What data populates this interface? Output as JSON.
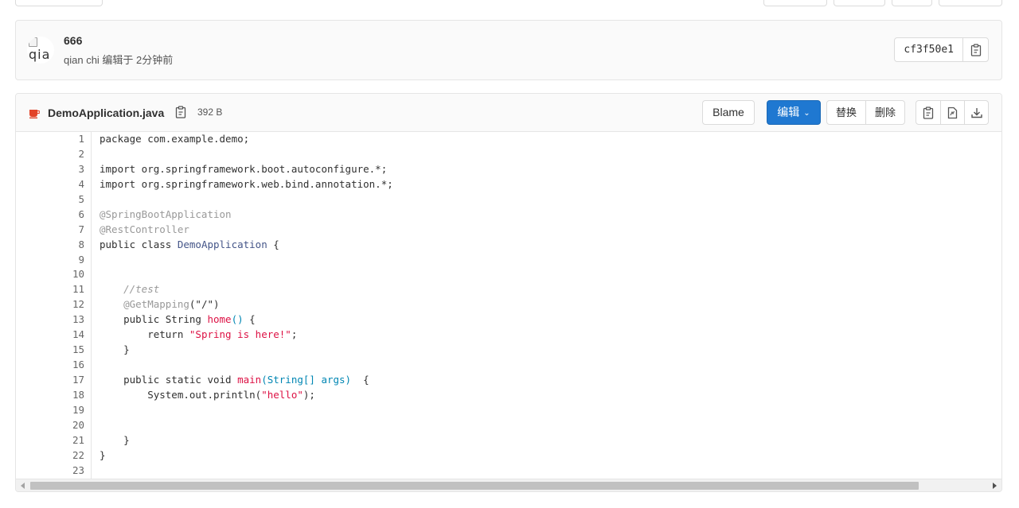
{
  "commit": {
    "title": "666",
    "author": "qian chi",
    "meta_text": "qian chi 编辑于 2分钟前",
    "avatar_alt": "qia",
    "sha": "cf3f50e1"
  },
  "file": {
    "name": "DemoApplication.java",
    "size": "392 B",
    "buttons": {
      "blame": "Blame",
      "edit": "编辑",
      "replace": "替换",
      "delete": "删除"
    },
    "icons": {
      "file": "java-file-icon",
      "copy_path": "copy-icon",
      "copy_contents": "copy-file-contents-icon",
      "raw": "open-raw-icon",
      "download": "download-icon"
    },
    "colors": {
      "edit_button": "#1f78d1",
      "file_icon": "#e24329"
    }
  },
  "code_lines": [
    [
      {
        "t": "package com.example.demo;"
      }
    ],
    [],
    [
      {
        "t": "import org.springframework.boot.autoconfigure.*;"
      }
    ],
    [
      {
        "t": "import org.springframework.web.bind.annotation.*;"
      }
    ],
    [],
    [
      {
        "t": "@SpringBootApplication",
        "c": "ann"
      }
    ],
    [
      {
        "t": "@RestController",
        "c": "ann"
      }
    ],
    [
      {
        "t": "public class "
      },
      {
        "t": "DemoApplication",
        "c": "cls"
      },
      {
        "t": " {"
      }
    ],
    [],
    [],
    [
      {
        "t": "    "
      },
      {
        "t": "//test",
        "c": "com"
      }
    ],
    [
      {
        "t": "    "
      },
      {
        "t": "@GetMapping",
        "c": "ann"
      },
      {
        "t": "(\"/\")"
      }
    ],
    [
      {
        "t": "    public String "
      },
      {
        "t": "home",
        "c": "fn"
      },
      {
        "t": "()",
        "c": "par"
      },
      {
        "t": " {"
      }
    ],
    [
      {
        "t": "        return "
      },
      {
        "t": "\"Spring is here!\"",
        "c": "str"
      },
      {
        "t": ";"
      }
    ],
    [
      {
        "t": "    }"
      }
    ],
    [],
    [
      {
        "t": "    public static void "
      },
      {
        "t": "main",
        "c": "fn"
      },
      {
        "t": "(String[] args)",
        "c": "par"
      },
      {
        "t": "  {"
      }
    ],
    [
      {
        "t": "        System.out.println("
      },
      {
        "t": "\"hello\"",
        "c": "str"
      },
      {
        "t": ");"
      }
    ],
    [],
    [],
    [
      {
        "t": "    }"
      }
    ],
    [
      {
        "t": "}"
      }
    ],
    []
  ]
}
